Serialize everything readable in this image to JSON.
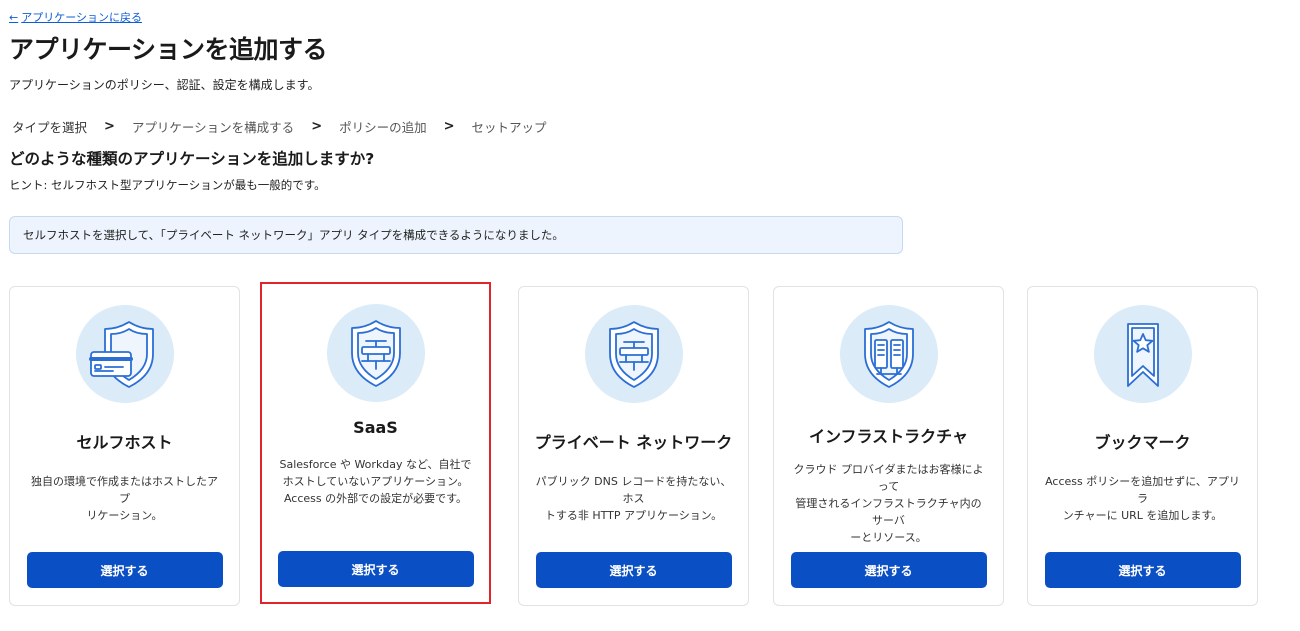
{
  "nav": {
    "back_label": "アプリケーションに戻る"
  },
  "header": {
    "title": "アプリケーションを追加する",
    "subtitle": "アプリケーションのポリシー、認証、設定を構成します。"
  },
  "steps": [
    {
      "label": "タイプを選択"
    },
    {
      "label": "アプリケーションを構成する"
    },
    {
      "label": "ポリシーの追加"
    },
    {
      "label": "セットアップ"
    }
  ],
  "step_separator": ">",
  "question": {
    "title": "どのような種類のアプリケーションを追加しますか?",
    "hint": "ヒント: セルフホスト型アプリケーションが最も一般的です。"
  },
  "banner": {
    "text": "セルフホストを選択して、「プライベート ネットワーク」アプリ タイプを構成できるようになりました。"
  },
  "cards": [
    {
      "icon": "shield-card-icon",
      "title": "セルフホスト",
      "desc_lines": [
        "独自の環境で作成またはホストしたアプ",
        "リケーション。"
      ],
      "button": "選択する",
      "selected": false
    },
    {
      "icon": "shield-network-icon",
      "title": "SaaS",
      "desc_lines": [
        "Salesforce や Workday など、自社で",
        "ホストしていないアプリケーション。",
        "Access の外部での設定が必要です。"
      ],
      "button": "選択する",
      "selected": true
    },
    {
      "icon": "shield-network-icon",
      "title": "プライベート ネットワーク",
      "desc_lines": [
        "パブリック DNS レコードを持たない、ホス",
        "トする非 HTTP アプリケーション。"
      ],
      "button": "選択する",
      "selected": false
    },
    {
      "icon": "server-shield-icon",
      "title": "インフラストラクチャ",
      "desc_lines": [
        "クラウド プロバイダまたはお客様によって",
        "管理されるインフラストラクチャ内のサーバ",
        "ーとリソース。"
      ],
      "button": "選択する",
      "selected": false
    },
    {
      "icon": "bookmark-star-icon",
      "title": "ブックマーク",
      "desc_lines": [
        "Access ポリシーを追加せずに、アプリ ラ",
        "ンチャーに URL を追加します。"
      ],
      "button": "選択する",
      "selected": false
    }
  ],
  "colors": {
    "link": "#0b5ed7",
    "button": "#0b4fc4",
    "banner_bg": "#edf4fd",
    "banner_border": "#c6dbf3",
    "icon_circle": "#dcebf8",
    "icon_stroke": "#2b6fd6",
    "selected_border": "#e0242c"
  }
}
